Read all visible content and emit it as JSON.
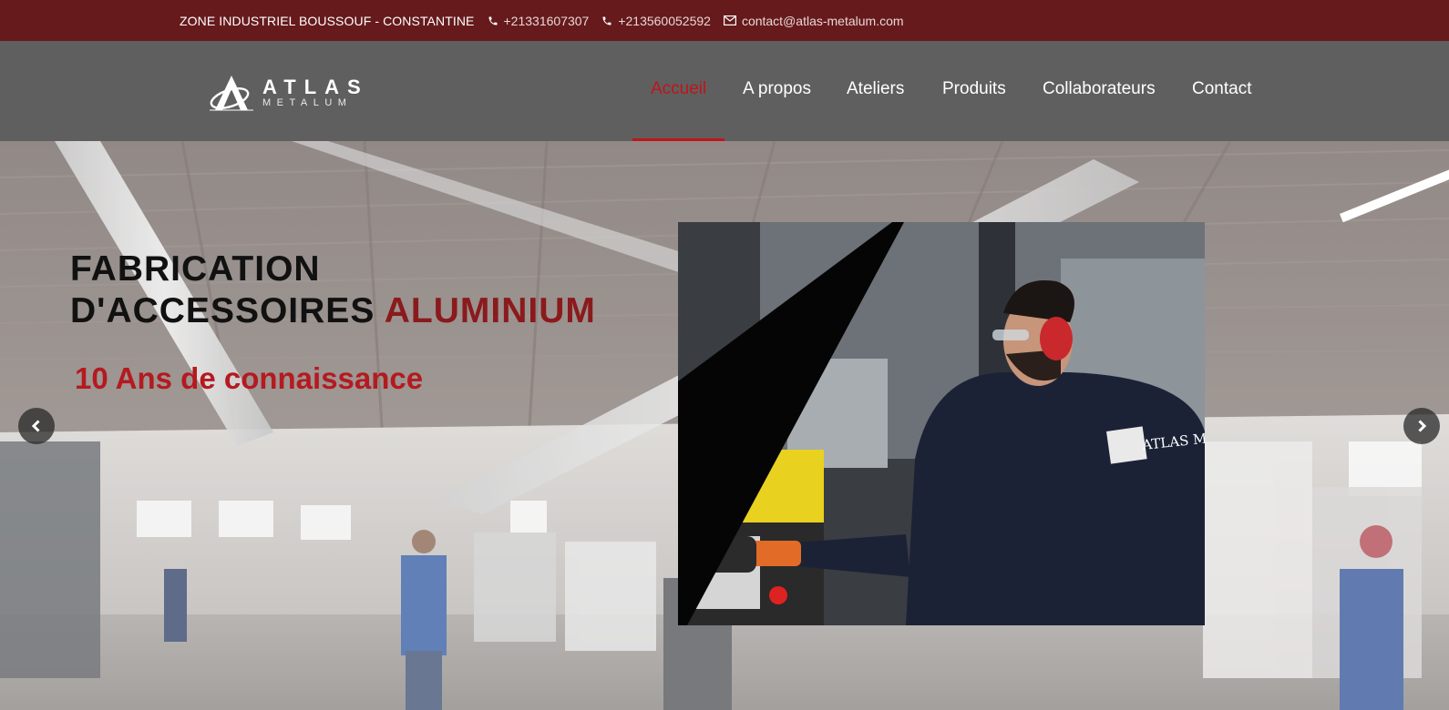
{
  "topbar": {
    "address": "ZONE INDUSTRIEL BOUSSOUF - CONSTANTINE",
    "phone1": "+21331607307",
    "phone2": "+213560052592",
    "email": "contact@atlas-metalum.com",
    "phone_icon": "phone-icon",
    "email_icon": "envelope-icon",
    "background": "#661a1c"
  },
  "logo": {
    "name": "ATLAS",
    "subtitle": "METALUM"
  },
  "nav": {
    "items": [
      {
        "label": "Accueil",
        "active": true
      },
      {
        "label": "A propos",
        "active": false
      },
      {
        "label": "Ateliers",
        "active": false
      },
      {
        "label": "Produits",
        "active": false
      },
      {
        "label": "Collaborateurs",
        "active": false
      },
      {
        "label": "Contact",
        "active": false
      }
    ],
    "accent": "#c0141b"
  },
  "hero": {
    "title_line1": "FABRICATION",
    "title_line2": "D'ACCESSOIRES",
    "title_accent": "ALUMINIUM",
    "subtitle": "10 Ans de connaissance",
    "prev_icon": "chevron-left-icon",
    "next_icon": "chevron-right-icon",
    "shirt_text": "ATLAS METALUM"
  }
}
